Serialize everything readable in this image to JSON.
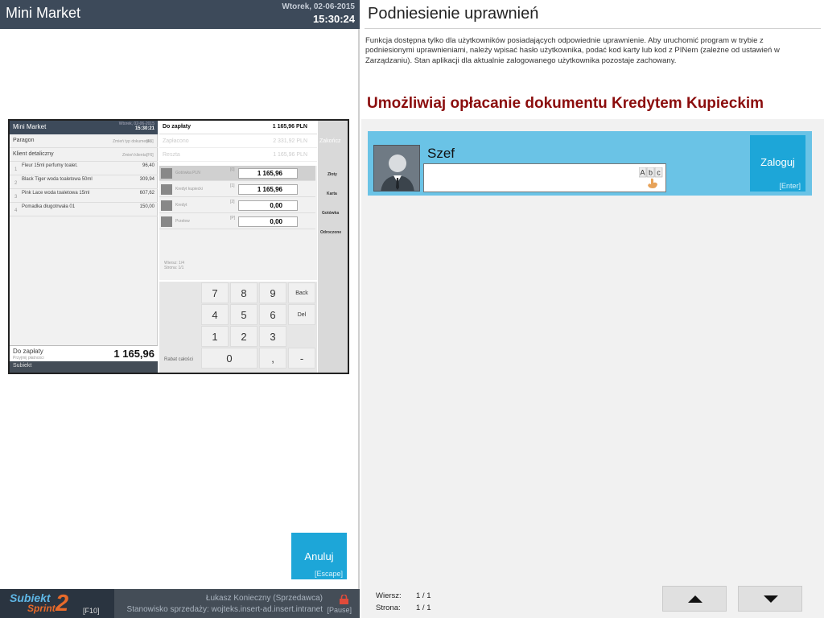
{
  "left": {
    "app_title": "Mini Market",
    "date": "Wtorek, 02-06-2015",
    "time": "15:30:24",
    "cancel_label": "Anuluj",
    "cancel_key": "[Escape]"
  },
  "preview": {
    "app_title": "Mini Market",
    "date": "Wtorek, 02-06-2015",
    "time": "15:30:21",
    "doc_type": "Paragon",
    "doc_type_hint": "Zmień typ dokumentu",
    "doc_type_key": "[F5]",
    "client": "Klient detaliczny",
    "client_hint": "Zmień klienta",
    "client_key": "[F6]",
    "items": [
      {
        "no": "1",
        "name": "Fleur 15ml perfumy toalet.",
        "price": "96,40"
      },
      {
        "no": "2",
        "name": "Black Tiger woda toaletowa 50ml",
        "price": "309,94"
      },
      {
        "no": "3",
        "name": "Pink Lace woda toaletowa 15ml",
        "price": "607,62"
      },
      {
        "no": "4",
        "name": "Pomadka długotrwała 01",
        "price": "150,00"
      }
    ],
    "to_pay_label": "Do zapłaty",
    "to_pay_sub": "Przyjmij płatności",
    "to_pay_total": "1 165,96",
    "logo_small": "Subiekt",
    "due_label": "Do zapłaty",
    "due_value": "1 165,96 PLN",
    "paid_label": "Zapłacono",
    "paid_value": "2 331,92 PLN",
    "change_label": "Reszta",
    "change_value": "1 165,96 PLN",
    "methods": [
      {
        "name": "Gotówka PLN",
        "key": "[0]",
        "value": "1 165,96",
        "cur": "PLN"
      },
      {
        "name": "Kredyt kupiecki",
        "key": "[1]",
        "value": "1 165,96",
        "cur": "PLN"
      },
      {
        "name": "Kredyt",
        "key": "[2]",
        "value": "0,00",
        "cur": "PLN"
      },
      {
        "name": "Przelew",
        "key": "[P]",
        "value": "0,00",
        "cur": "PLN"
      }
    ],
    "finish": "Zakończ",
    "side": [
      "Złoty",
      "Karta",
      "Gotówka",
      "Odroczone"
    ],
    "pager_row": "Wiersz: 1/4",
    "pager_page": "Strona: 1/1",
    "discount": "Rabat całości",
    "keys": [
      "7",
      "8",
      "9",
      "Back",
      "4",
      "5",
      "6",
      "Del",
      "1",
      "2",
      "3",
      "",
      "0",
      ",",
      "-"
    ]
  },
  "bottom": {
    "logo_word": "Subiekt",
    "logo_sub": "Sprint",
    "logo_num": "2",
    "logo_key": "[F10]",
    "user": "Łukasz Konieczny (Sprzedawca)",
    "station": "Stanowisko sprzedaży: wojteks.insert-ad.insert.intranet",
    "pause_key": "[Pause]"
  },
  "right": {
    "title": "Podniesienie uprawnień",
    "description": "Funkcja dostępna tylko dla użytkowników posiadających odpowiednie uprawnienie. Aby uruchomić program w trybie z podniesionymi uprawnieniami, należy wpisać hasło użytkownika, podać kod karty lub kod z PINem (zależne od ustawień w Zarządzaniu). Stan aplikacji dla aktualnie zalogowanego użytkownika pozostaje zachowany.",
    "permission": "Umożliwiaj opłacanie dokumentu Kredytem Kupieckim",
    "user_name": "Szef",
    "password_value": "",
    "keyboard_letters": "Abc",
    "login_label": "Zaloguj",
    "login_key": "[Enter]",
    "row_label": "Wiersz:",
    "row_value": "1 / 1",
    "page_label": "Strona:",
    "page_value": "1 / 1"
  },
  "colors": {
    "accent": "#1da6d8",
    "card": "#6ac3e6",
    "heading": "#8b0d0d",
    "topbar": "#3d4a5a"
  }
}
